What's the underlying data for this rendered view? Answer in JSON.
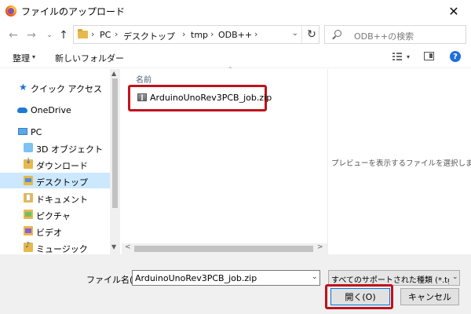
{
  "window": {
    "title": "ファイルのアップロード",
    "close_glyph": "✕"
  },
  "nav": {
    "back_glyph": "←",
    "forward_glyph": "→",
    "recent_glyph": "⌄",
    "up_glyph": "↑",
    "refresh_glyph": "↻"
  },
  "address": {
    "separator": "›",
    "crumbs": [
      "PC",
      "デスクトップ",
      "tmp",
      "ODB++"
    ],
    "dropdown_glyph": "⌄"
  },
  "search": {
    "placeholder": "ODB++の検索"
  },
  "toolbar": {
    "organize_label": "整理",
    "organize_arrow": "▾",
    "new_folder_label": "新しいフォルダー",
    "view_arrow": "▾",
    "help_glyph": "?"
  },
  "sidebar": {
    "items": [
      {
        "label": "クイック アクセス",
        "icon": "star-icon"
      },
      {
        "label": "OneDrive",
        "icon": "cloud-icon"
      },
      {
        "label": "PC",
        "icon": "computer-icon"
      },
      {
        "label": "3D オブジェクト",
        "icon": "3d-objects-folder-icon"
      },
      {
        "label": "ダウンロード",
        "icon": "downloads-folder-icon"
      },
      {
        "label": "デスクトップ",
        "icon": "desktop-folder-icon",
        "selected": true
      },
      {
        "label": "ドキュメント",
        "icon": "documents-folder-icon"
      },
      {
        "label": "ピクチャ",
        "icon": "pictures-folder-icon"
      },
      {
        "label": "ビデオ",
        "icon": "videos-folder-icon"
      },
      {
        "label": "ミュージック",
        "icon": "music-folder-icon"
      }
    ],
    "scroll_up_glyph": "▲",
    "scroll_down_glyph": "▼"
  },
  "filelist": {
    "column_name": "名前",
    "sort_glyph": "⌃",
    "files": [
      {
        "name": "ArduinoUnoRev3PCB_job.zip",
        "icon": "zip-file-icon",
        "highlighted": true
      }
    ],
    "scroll_left_glyph": "<",
    "scroll_right_glyph": ">"
  },
  "preview": {
    "message": "プレビューを表示するファイルを選択します。"
  },
  "footer": {
    "filename_label": "ファイル名(N):",
    "filename_value": "ArduinoUnoRev3PCB_job.zip",
    "filename_arrow": "⌄",
    "filter_value": "すべてのサポートされた種類 (*.tgz;*.",
    "filter_arrow": "⌄",
    "open_label": "開く(O)",
    "cancel_label": "キャンセル"
  },
  "colors": {
    "highlight_border": "#c0121b",
    "selection_bg": "#cce8ff",
    "accent": "#0078d7"
  }
}
